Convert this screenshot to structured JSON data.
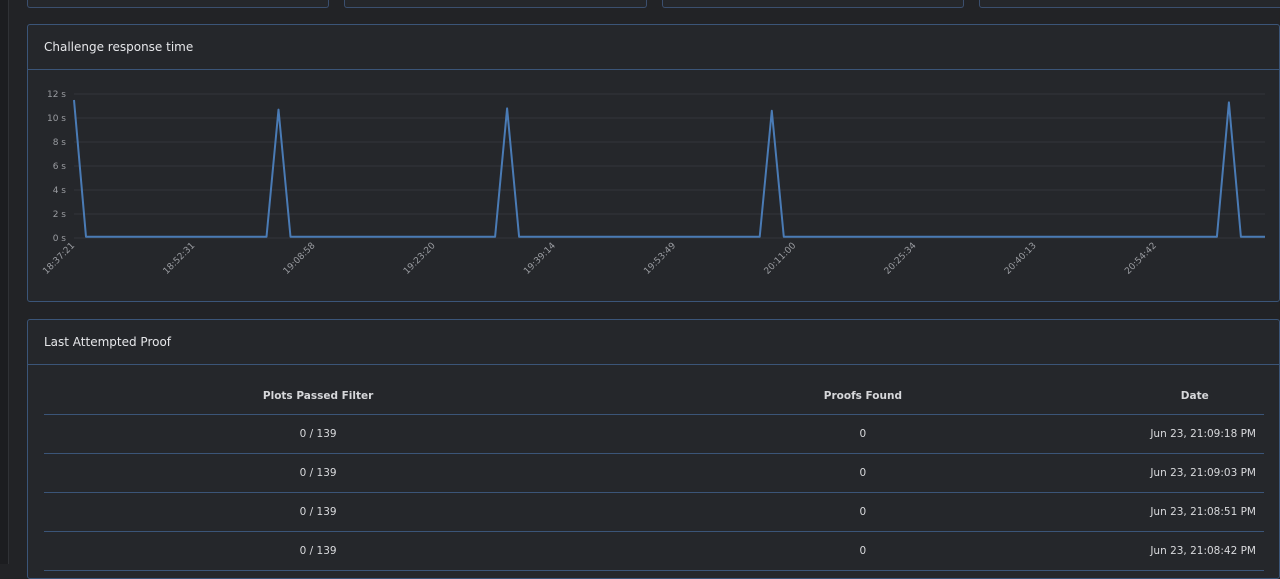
{
  "chart_card": {
    "title": "Challenge response time"
  },
  "proof_card": {
    "title": "Last Attempted Proof",
    "columns": [
      "Plots Passed Filter",
      "Proofs Found",
      "Date"
    ],
    "rows": [
      [
        "0 / 139",
        "0",
        "Jun 23, 21:09:18 PM"
      ],
      [
        "0 / 139",
        "0",
        "Jun 23, 21:09:03 PM"
      ],
      [
        "0 / 139",
        "0",
        "Jun 23, 21:08:51 PM"
      ],
      [
        "0 / 139",
        "0",
        "Jun 23, 21:08:42 PM"
      ]
    ]
  },
  "colors": {
    "line": "#4a7bb5",
    "grid": "#34363b",
    "tick_text": "#9a9ca1"
  },
  "chart_data": {
    "type": "line",
    "title": "",
    "xlabel": "",
    "ylabel": "",
    "ylim": [
      0,
      12
    ],
    "y_ticks": [
      "0 s",
      "2 s",
      "4 s",
      "6 s",
      "8 s",
      "10 s",
      "12 s"
    ],
    "x_tick_labels": [
      "18:37:21",
      "18:52:31",
      "19:08:58",
      "19:23:20",
      "19:39:14",
      "19:53:49",
      "20:11:00",
      "20:25:34",
      "20:40:13",
      "20:54:42"
    ],
    "grid": true,
    "legend": "none",
    "series": [
      {
        "values": [
          11.5,
          0.1,
          0.1,
          0.1,
          0.1,
          0.1,
          0.1,
          0.1,
          0.1,
          0.1,
          0.1,
          0.1,
          0.1,
          0.1,
          0.1,
          0.1,
          0.1,
          10.7,
          0.1,
          0.1,
          0.1,
          0.1,
          0.1,
          0.1,
          0.1,
          0.1,
          0.1,
          0.1,
          0.1,
          0.1,
          0.1,
          0.1,
          0.1,
          0.1,
          0.1,
          0.1,
          10.8,
          0.1,
          0.1,
          0.1,
          0.1,
          0.1,
          0.1,
          0.1,
          0.1,
          0.1,
          0.1,
          0.1,
          0.1,
          0.1,
          0.1,
          0.1,
          0.1,
          0.1,
          0.1,
          0.1,
          0.1,
          0.1,
          10.6,
          0.1,
          0.1,
          0.1,
          0.1,
          0.1,
          0.1,
          0.1,
          0.1,
          0.1,
          0.1,
          0.1,
          0.1,
          0.1,
          0.1,
          0.1,
          0.1,
          0.1,
          0.1,
          0.1,
          0.1,
          0.1,
          0.1,
          0.1,
          0.1,
          0.1,
          0.1,
          0.1,
          0.1,
          0.1,
          0.1,
          0.1,
          0.1,
          0.1,
          0.1,
          0.1,
          0.1,
          0.1,
          11.3,
          0.1,
          0.1,
          0.1
        ]
      }
    ]
  }
}
